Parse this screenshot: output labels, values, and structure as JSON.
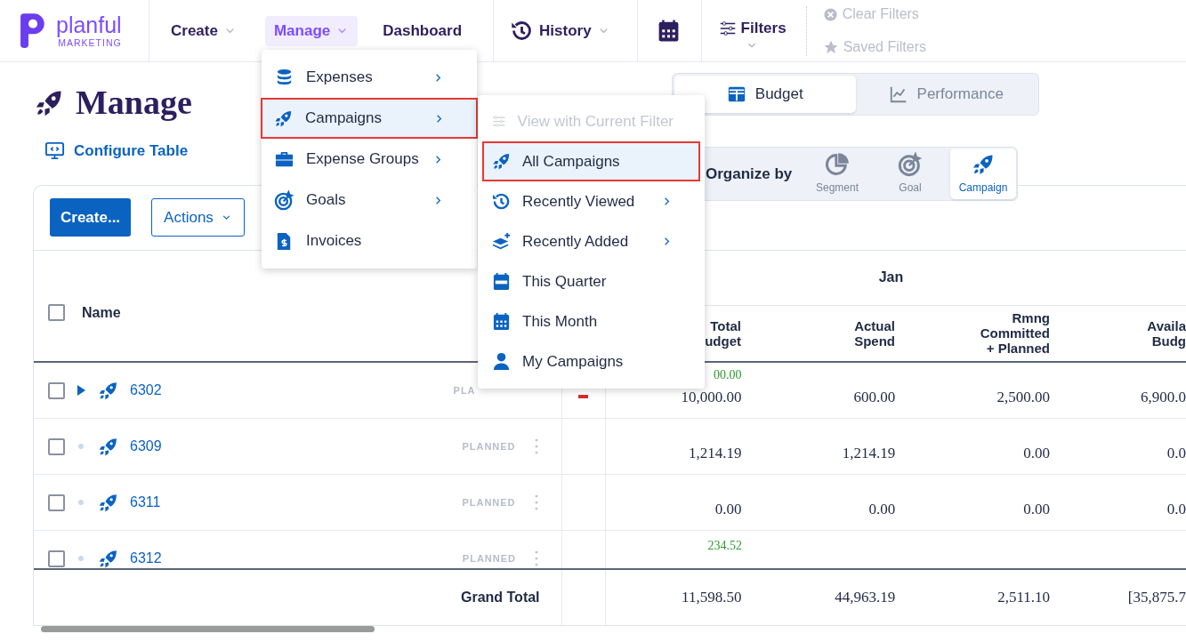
{
  "brand": {
    "name": "planful",
    "tagline": "MARKETING"
  },
  "nav": [
    {
      "label": "Create",
      "dropdown": true,
      "selected": false
    },
    {
      "label": "Manage",
      "dropdown": true,
      "selected": true
    },
    {
      "label": "Dashboard",
      "dropdown": false,
      "selected": false
    },
    {
      "label": "History",
      "dropdown": true,
      "selected": false
    }
  ],
  "filters": {
    "label": "Filters"
  },
  "filter_actions": [
    {
      "label": "Clear Filters",
      "disabled": true
    },
    {
      "label": "Saved Filters",
      "disabled": true
    }
  ],
  "page": {
    "title": "Manage",
    "configure_label": "Configure Table"
  },
  "view_tabs": [
    {
      "label": "Budget",
      "selected": true
    },
    {
      "label": "Performance",
      "selected": false
    }
  ],
  "organize": {
    "label": "Organize by",
    "options": [
      {
        "label": "Segment",
        "selected": false
      },
      {
        "label": "Goal",
        "selected": false
      },
      {
        "label": "Campaign",
        "selected": true
      }
    ]
  },
  "toolbar": {
    "create": "Create...",
    "actions": "Actions"
  },
  "table": {
    "period": "Jan",
    "name_header": "Name",
    "header_checked": false,
    "columns": [
      [
        "Total",
        "udget"
      ],
      [
        "Actual",
        "Spend"
      ],
      [
        "Rmng",
        "Committed",
        "+ Planned"
      ],
      [
        "Availa",
        "Budg"
      ]
    ],
    "rows": [
      {
        "name": "6302",
        "status": "PLA",
        "expandable": true,
        "checked": false,
        "flagged": true,
        "note": "00.00",
        "values": [
          "10,000.00",
          "600.00",
          "2,500.00",
          "6,900.0"
        ]
      },
      {
        "name": "6309",
        "status": "PLANNED",
        "expandable": false,
        "checked": false,
        "flagged": false,
        "values": [
          "1,214.19",
          "1,214.19",
          "0.00",
          "0.0"
        ]
      },
      {
        "name": "6311",
        "status": "PLANNED",
        "expandable": false,
        "checked": false,
        "flagged": false,
        "values": [
          "0.00",
          "0.00",
          "0.00",
          "0.0"
        ]
      },
      {
        "name": "6312",
        "status": "PLANNED",
        "expandable": false,
        "checked": false,
        "flagged": false,
        "note": "234.52"
      }
    ],
    "total": {
      "label": "Grand Total",
      "values": [
        "11,598.50",
        "44,963.19",
        "2,511.10",
        "[35,875.7"
      ]
    }
  },
  "manage_menu": [
    {
      "label": "Expenses",
      "selected": false,
      "submenu": true
    },
    {
      "label": "Campaigns",
      "selected": true,
      "submenu": true
    },
    {
      "label": "Expense Groups",
      "selected": false,
      "submenu": true
    },
    {
      "label": "Goals",
      "selected": false,
      "submenu": true
    },
    {
      "label": "Invoices",
      "selected": false,
      "submenu": false
    }
  ],
  "campaigns_submenu": [
    {
      "label": "View with Current Filter",
      "selected": false,
      "disabled": true,
      "submenu": false
    },
    {
      "label": "All Campaigns",
      "selected": true,
      "disabled": false,
      "submenu": false
    },
    {
      "label": "Recently Viewed",
      "selected": false,
      "disabled": false,
      "submenu": true
    },
    {
      "label": "Recently Added",
      "selected": false,
      "disabled": false,
      "submenu": true
    },
    {
      "label": "This Quarter",
      "selected": false,
      "disabled": false,
      "submenu": false
    },
    {
      "label": "This Month",
      "selected": false,
      "disabled": false,
      "submenu": false
    },
    {
      "label": "My Campaigns",
      "selected": false,
      "disabled": false,
      "submenu": false
    }
  ]
}
